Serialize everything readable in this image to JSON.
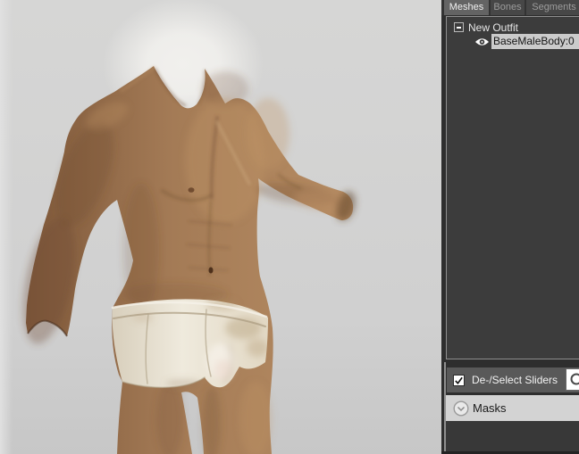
{
  "right_panel": {
    "tabs": [
      {
        "label": "Meshes",
        "active": true
      },
      {
        "label": "Bones",
        "active": false
      },
      {
        "label": "Segments",
        "active": false
      }
    ],
    "tree": {
      "root_item": {
        "label": "New Outfit",
        "icon": "minus-collapse-box",
        "expanded": true
      },
      "child_item": {
        "label": "BaseMaleBody:0",
        "icon": "eye-visibility",
        "selected": true
      }
    },
    "sliders_bar": {
      "label": "De-/Select Sliders",
      "checked": true,
      "icon": "checkbox-checked"
    },
    "search_box": {
      "icon": "magnifier",
      "value": ""
    },
    "masks_header": {
      "label": "Masks",
      "icon": "chevron-down-circle",
      "collapsed": false
    }
  },
  "colors": {
    "viewport_bg": "#d6d6d5",
    "skin_base": "#a47b56",
    "skin_dark": "#6e4b30",
    "skin_light": "#c09468",
    "briefs_light": "#efeadd",
    "briefs_shade": "#d8cfbc",
    "panel_bg": "#2e2e2e",
    "tab_active_bg": "#646464",
    "tab_inactive_bg": "#474747",
    "tab_active_text": "#efefef",
    "tab_inactive_text": "#9c9c9c",
    "tree_bg": "#3c3c3c",
    "tree_border": "#8f8f8f",
    "tree_text": "#e6e6e6",
    "selection_bg": "#cbcbcb",
    "selection_text": "#151515",
    "toolbar_bg": "#595959",
    "toolbar_text": "#f2f2f2",
    "masks_bg": "#d3d3d3",
    "masks_text": "#1a1a1a"
  }
}
